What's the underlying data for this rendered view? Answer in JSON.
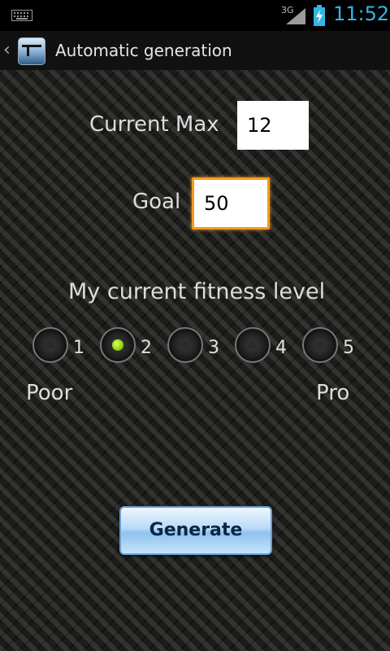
{
  "status_bar": {
    "network": "3G",
    "time": "11:52"
  },
  "action_bar": {
    "title": "Automatic generation"
  },
  "form": {
    "current_max_label": "Current Max",
    "current_max_value": "12",
    "goal_label": "Goal",
    "goal_value": "50",
    "fitness_label": "My current fitness level",
    "fitness_options": [
      "1",
      "2",
      "3",
      "4",
      "5"
    ],
    "selected_fitness": "2",
    "scale_low_label": "Poor",
    "scale_high_label": "Pro"
  },
  "generate_button": {
    "label": "Generate"
  },
  "colors": {
    "accent": "#33b5e5",
    "focus": "#f39a1e",
    "selected_radio": "#8fd400"
  }
}
